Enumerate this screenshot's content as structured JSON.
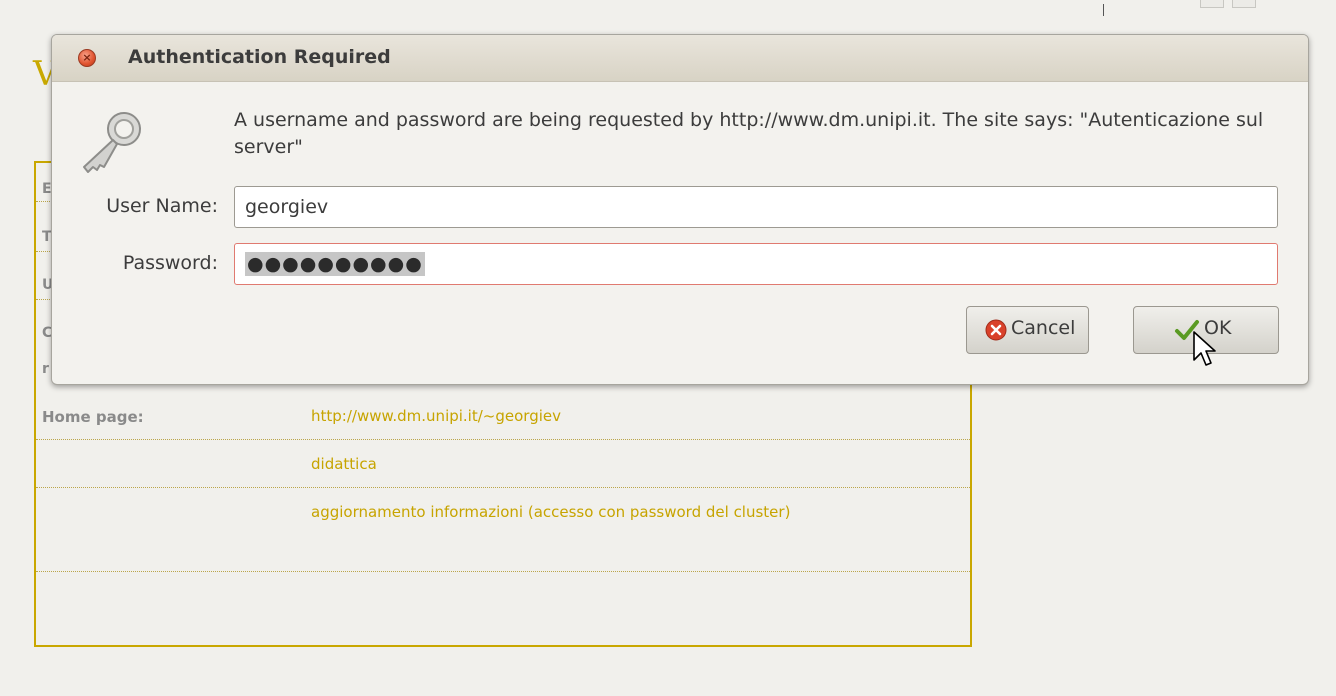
{
  "page": {
    "heading": "V",
    "table_stubs": [
      "E",
      "T",
      "U",
      "C",
      "r"
    ],
    "rows": [
      {
        "label": "Home page:",
        "value": "http://www.dm.unipi.it/~georgiev"
      },
      {
        "label": "",
        "value": "didattica"
      },
      {
        "label": "",
        "value": "aggiornamento informazioni (accesso con password del cluster)"
      }
    ]
  },
  "dialog": {
    "title": "Authentication Required",
    "message": "A username and password are being requested by http://www.dm.unipi.it. The site says: \"Autenticazione sul server\"",
    "username_label": "User Name:",
    "username_value": "georgiev",
    "password_label": "Password:",
    "password_mask": "●●●●●●●●●●",
    "cancel_label": "Cancel",
    "ok_label": "OK",
    "icons": {
      "close": "close-icon",
      "key": "key-icon",
      "cancel": "cancel-icon",
      "ok": "check-icon"
    }
  },
  "colors": {
    "accent": "#c9a700",
    "link": "#c7a400",
    "label": "#8a8a8a"
  }
}
